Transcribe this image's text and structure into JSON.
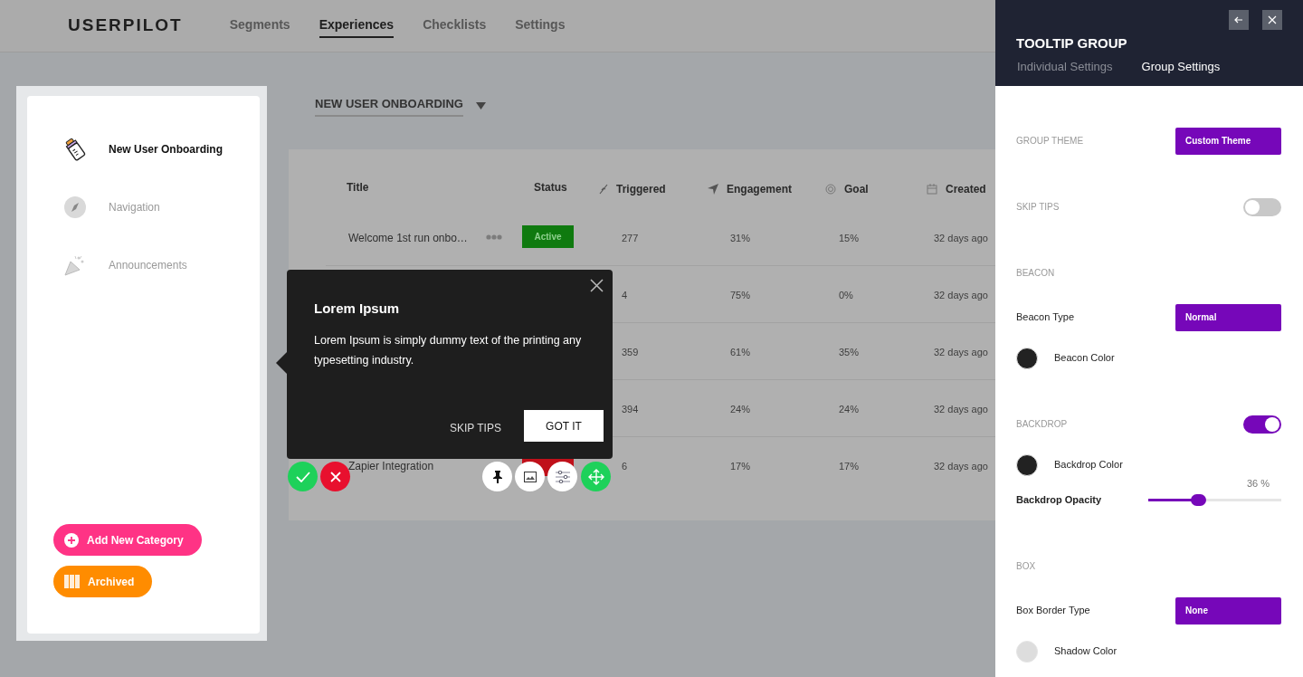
{
  "header": {
    "logo": "USERPILOT",
    "nav": [
      {
        "label": "Segments",
        "selected": false
      },
      {
        "label": "Experiences",
        "selected": true
      },
      {
        "label": "Checklists",
        "selected": false
      },
      {
        "label": "Settings",
        "selected": false
      }
    ]
  },
  "sidebar": {
    "items": [
      {
        "label": "New User Onboarding",
        "selected": true
      },
      {
        "label": "Navigation",
        "selected": false
      },
      {
        "label": "Announcements",
        "selected": false
      }
    ],
    "buttons": [
      {
        "label": "Add New Category",
        "kind": "add"
      },
      {
        "label": "Archived",
        "kind": "archive"
      }
    ]
  },
  "experience_dropdown": {
    "label": "NEW USER ONBOARDING"
  },
  "table": {
    "columns": [
      "Title",
      "Status",
      "Triggered",
      "Engagement",
      "Goal",
      "Created"
    ],
    "rows": [
      {
        "title": "Welcome 1st run onbo…",
        "status": {
          "kind": "active",
          "label": "Active"
        },
        "triggered": "277",
        "engagement": "31%",
        "goal": "15%",
        "created": "32 days ago"
      },
      {
        "triggered": "4",
        "engagement": "75%",
        "goal": "0%",
        "created": "32 days ago"
      },
      {
        "triggered": "359",
        "engagement": "61%",
        "goal": "35%",
        "created": "32 days ago"
      },
      {
        "triggered": "394",
        "engagement": "24%",
        "goal": "24%",
        "created": "32 days ago"
      },
      {
        "title": "Zapier Integration",
        "status": {
          "kind": "inactive"
        },
        "triggered": "6",
        "engagement": "17%",
        "goal": "17%",
        "created": "32 days ago"
      }
    ]
  },
  "tooltip": {
    "title": "Lorem Ipsum",
    "body": "Lorem Ipsum is simply dummy text of the printing any typesetting industry.",
    "secondary_button": "SKIP TIPS",
    "primary_button": "GOT IT"
  },
  "panel": {
    "title": "TOOLTIP GROUP",
    "tabs": [
      {
        "label": "Individual Settings",
        "selected": false
      },
      {
        "label": "Group Settings",
        "selected": true
      }
    ],
    "settings": [
      {
        "kind": "heading_select",
        "label": "GROUP THEME",
        "value": "Custom Theme"
      },
      {
        "kind": "heading_toggle",
        "label": "SKIP TIPS",
        "on": false
      },
      {
        "kind": "heading",
        "label": "BEACON"
      },
      {
        "kind": "select",
        "label": "Beacon Type",
        "value": "Normal"
      },
      {
        "kind": "color",
        "label": "Beacon Color",
        "color": "#222222"
      },
      {
        "kind": "heading_toggle",
        "label": "BACKDROP",
        "on": true
      },
      {
        "kind": "color",
        "label": "Backdrop Color",
        "color": "#222222"
      },
      {
        "kind": "slider",
        "label": "Backdrop Opacity",
        "level": 0.36,
        "reading": "36 %"
      },
      {
        "kind": "heading",
        "label": "BOX"
      },
      {
        "kind": "select",
        "label": "Box Border Type",
        "value": "None"
      },
      {
        "kind": "color",
        "label": "Shadow Color",
        "color": "#dddddd"
      }
    ]
  }
}
